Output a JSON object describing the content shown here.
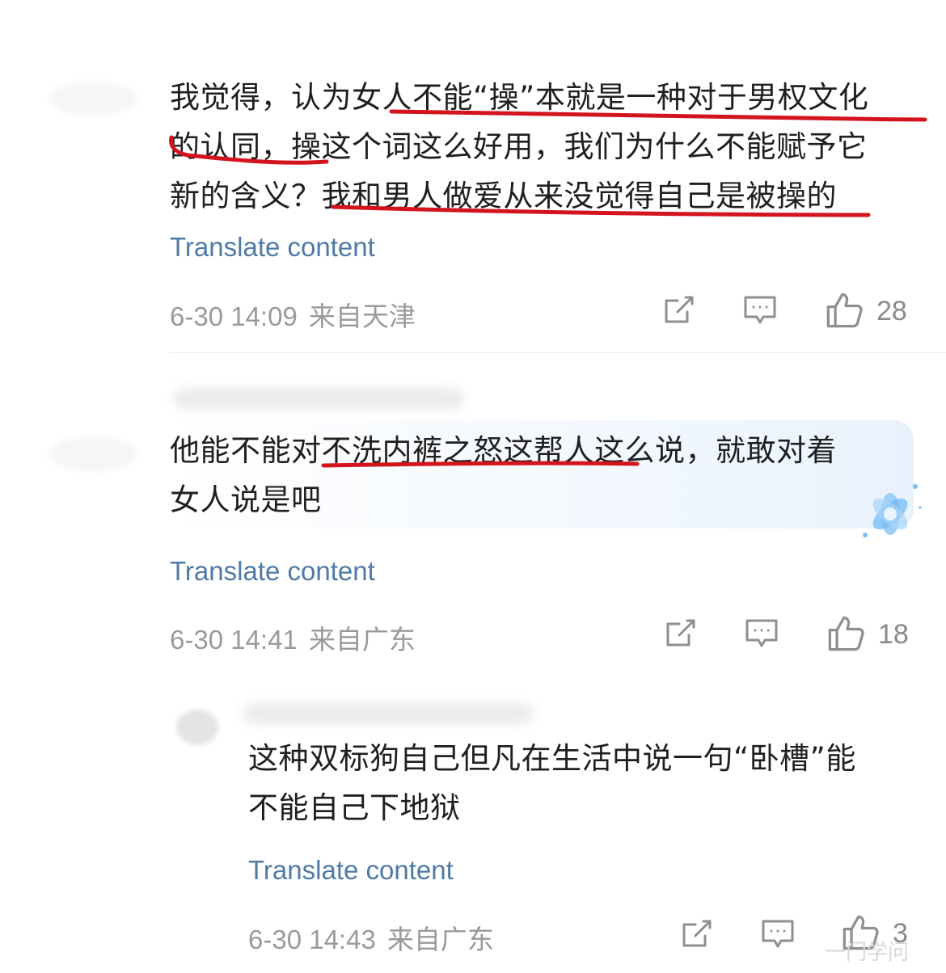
{
  "comments": [
    {
      "text": "我觉得，认为女人不能“操”本就是一种对于男权文化\n的认同，操这个词这么好用，我们为什么不能赋予它\n新的含义？我和男人做爱从来没觉得自己是被操的",
      "translate": "Translate content",
      "date": "6-30 14:09",
      "location": "来自天津",
      "likes": "28"
    },
    {
      "text": "他能不能对不洗内裤之怒这帮人这么说，就敢对着\n女人说是吧",
      "translate": "Translate content",
      "date": "6-30 14:41",
      "location": "来自广东",
      "likes": "18"
    },
    {
      "text": "这种双标狗自己但凡在生活中说一句“卧槽”能\n不能自己下地狱",
      "translate": "Translate content",
      "date": "6-30 14:43",
      "location": "来自广东",
      "likes": "3"
    }
  ],
  "icons": {
    "share": "share-icon",
    "comment": "comment-icon",
    "like": "thumbs-up-icon"
  },
  "colors": {
    "link": "#4f7aa6",
    "meta": "#9a9a9a",
    "annotation": "#d4141d"
  },
  "watermark": "一门学问"
}
